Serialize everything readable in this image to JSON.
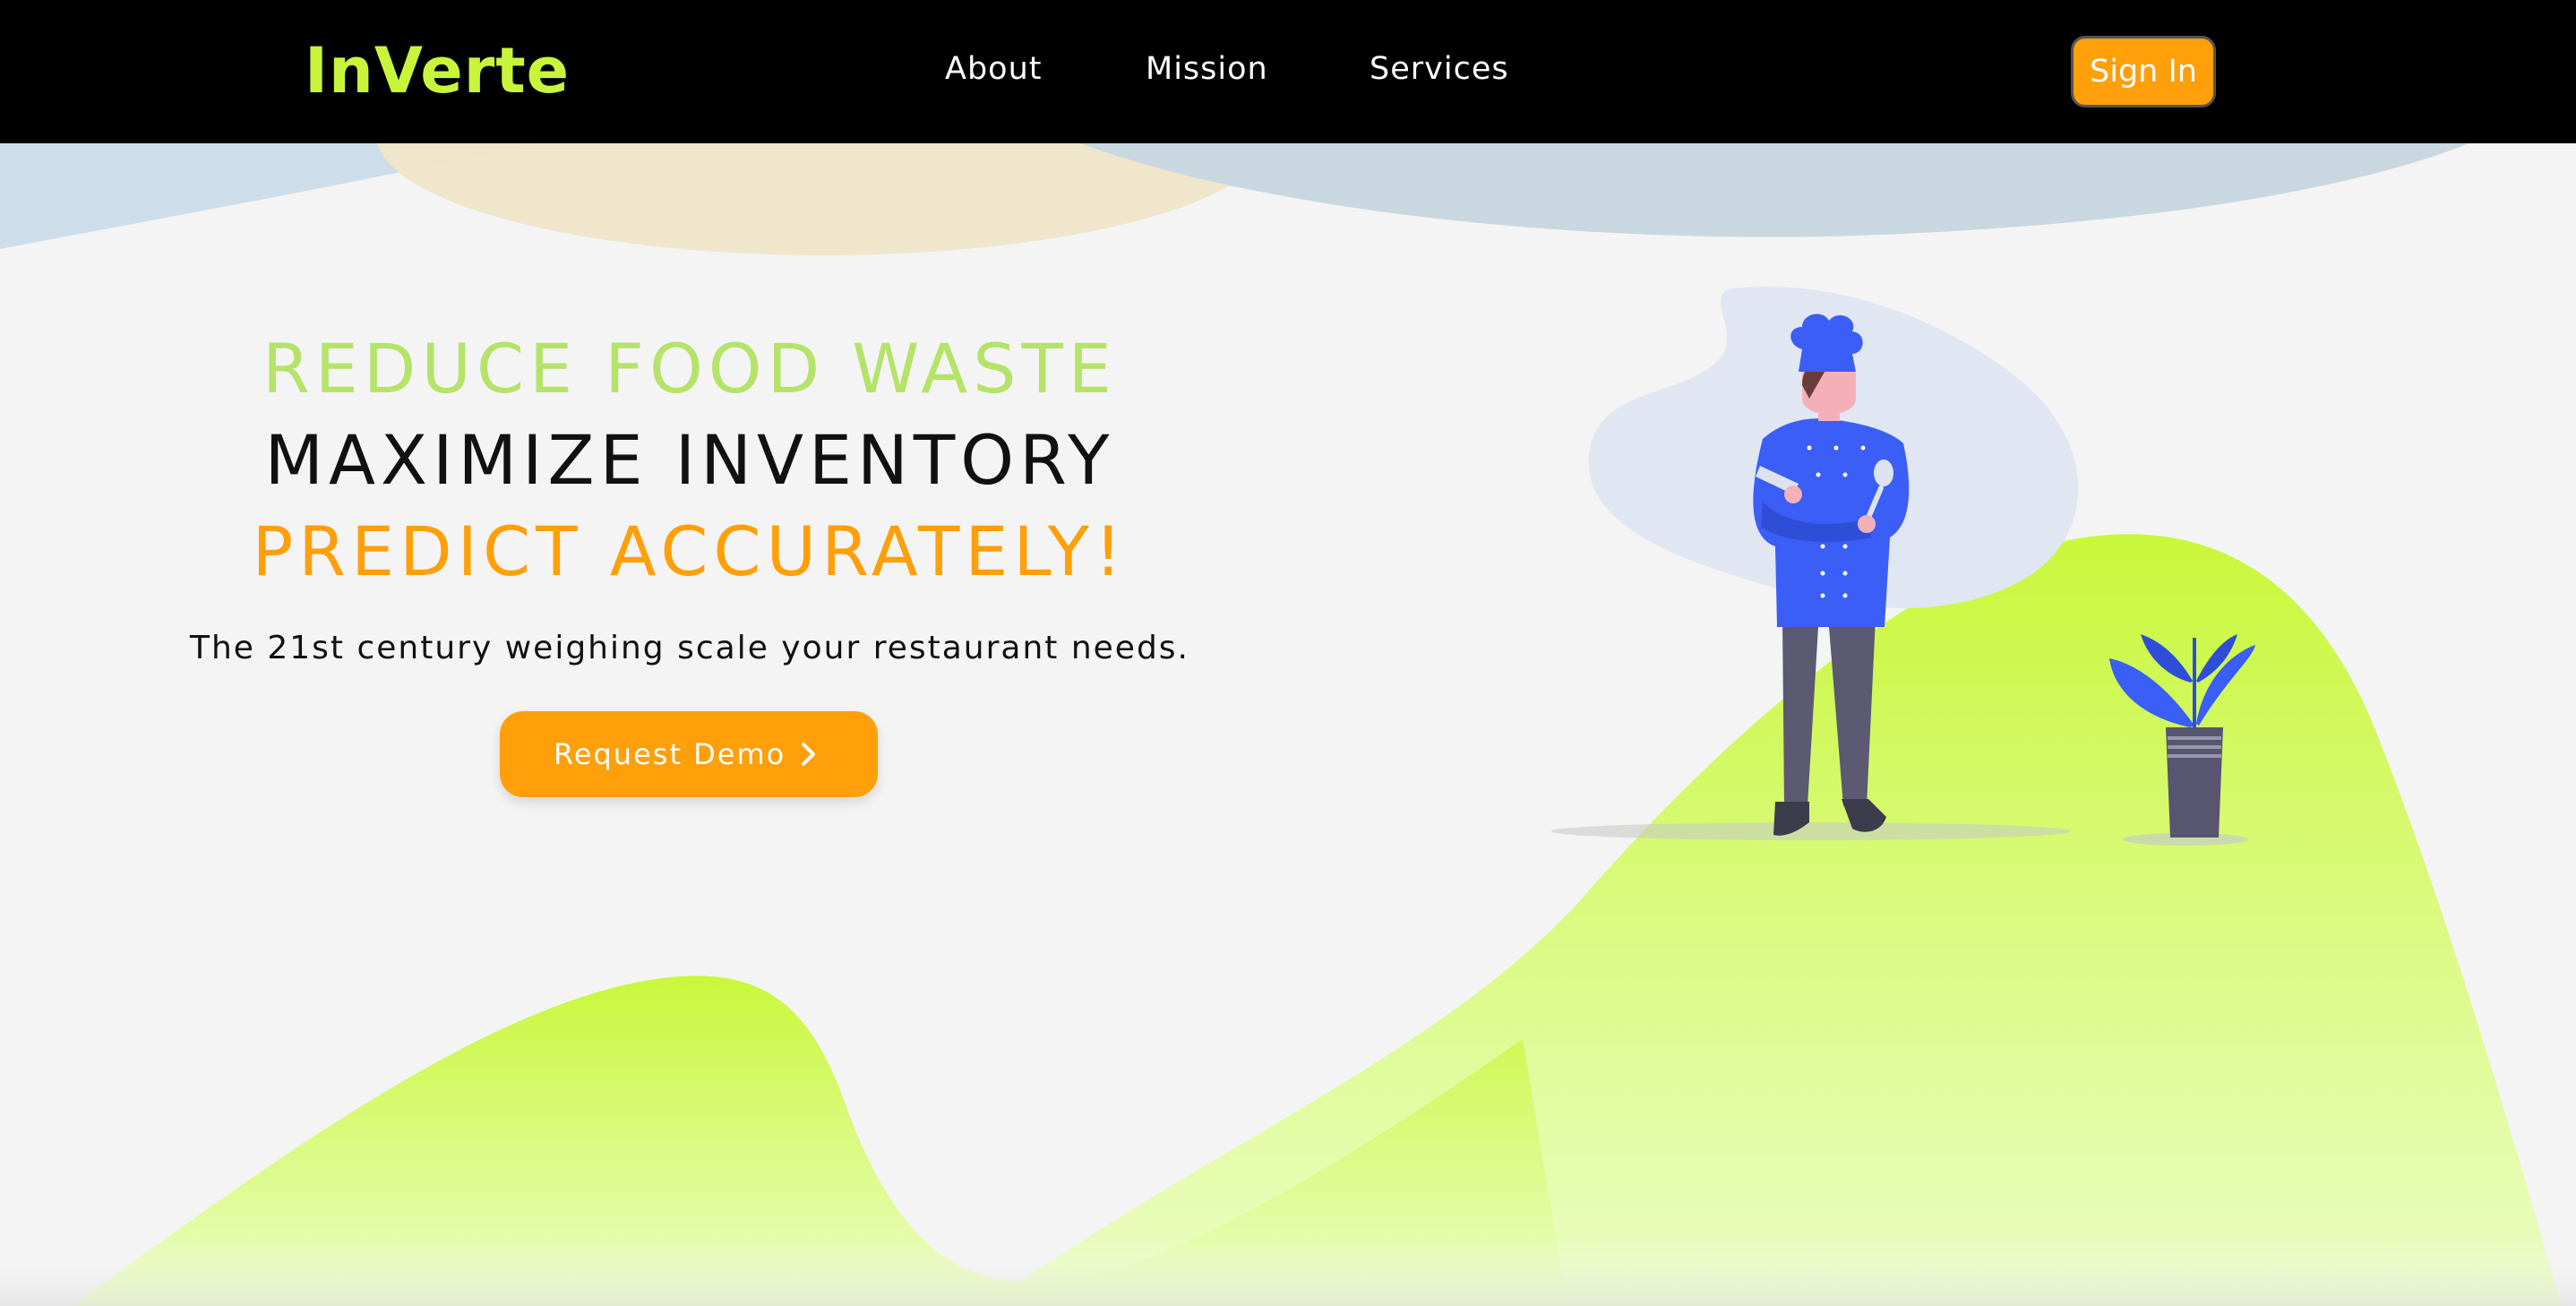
{
  "nav": {
    "logo": "InVerte",
    "links": [
      "About",
      "Mission",
      "Services"
    ],
    "signin_label": "Sign In"
  },
  "hero": {
    "line1": "REDUCE FOOD WASTE",
    "line2": "MAXIMIZE INVENTORY",
    "line3": "PREDICT ACCURATELY!",
    "tagline": "The 21st century weighing scale your restaurant needs.",
    "cta_label": "Request Demo",
    "cta_icon": "chevron-right-icon"
  },
  "colors": {
    "brand_lime": "#c8f53b",
    "accent_green": "#b5e36a",
    "accent_orange": "#ff9f0a",
    "text_dark": "#111111",
    "nav_bg": "#000000",
    "page_bg": "#f4f4f4",
    "chef_blue": "#3b5ef6"
  }
}
